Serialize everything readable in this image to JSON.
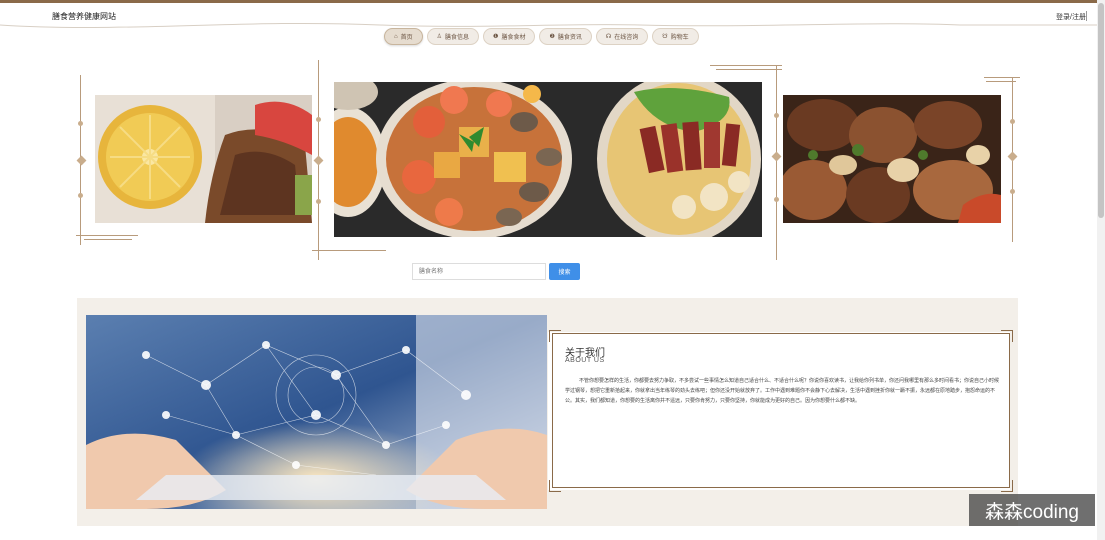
{
  "header": {
    "site_title": "膳食营养健康网站",
    "auth_link": "登录/注册"
  },
  "nav": {
    "items": [
      {
        "label": "首页",
        "icon": "⌂",
        "active": true
      },
      {
        "label": "膳食信息",
        "icon": "♙",
        "active": false
      },
      {
        "label": "膳食食材",
        "icon": "❶",
        "active": false
      },
      {
        "label": "膳食资讯",
        "icon": "❷",
        "active": false
      },
      {
        "label": "在线咨询",
        "icon": "☊",
        "active": false
      },
      {
        "label": "购物车",
        "icon": "☋",
        "active": false
      }
    ]
  },
  "carousel": {
    "slides": [
      {
        "name": "lemon-steak",
        "position": "left"
      },
      {
        "name": "seafood-platter",
        "position": "center"
      },
      {
        "name": "grilled-skewers",
        "position": "right"
      }
    ]
  },
  "search": {
    "placeholder": "膳食名称",
    "button_label": "搜索"
  },
  "about": {
    "title": "关于我们",
    "subtitle": "ABOUT US",
    "body": "不管你想要怎样的生活，你都要去努力争取，不多尝试一些事情怎么知道自己适合什么、不适合什么呢？你说你喜欢读书，让我给你列书单，你还问我哪里有那么多时间看书；你说自己小时候学过钢琴，想把它重新拾起来，你就拿出当年练琴的劲头去练吧；但你还没开始就放弃了。工作中遇到难题你不会静下心去解决，生活中遇到挫折你就一蹶不振，永远都在原地踏步，抱怨命运的不公。其实，我们都知道，你想要的生活离你并不遥远，只要你肯努力，只要你坚持，你就能成为更好的自己。因为你想要什么都不缺。"
  },
  "watermark": "森森coding",
  "colors": {
    "accent": "#8a6a49",
    "search_button": "#3f8fe8",
    "about_background": "#f3efe9"
  }
}
